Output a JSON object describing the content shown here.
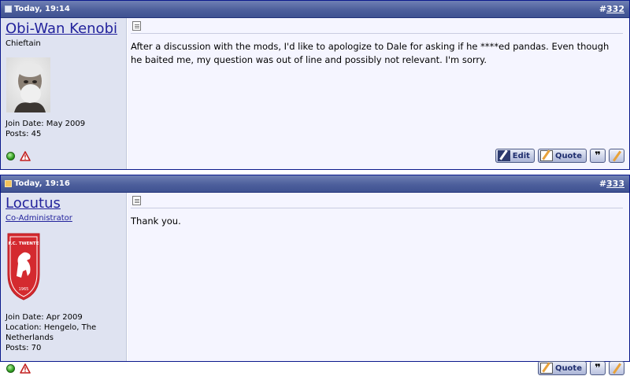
{
  "posts": [
    {
      "date": "Today, 19:14",
      "post_number_prefix": "#",
      "post_number": "332",
      "username": "Obi-Wan Kenobi",
      "user_title": "Chieftain",
      "join_date": "Join Date: May 2009",
      "location": "",
      "posts_count": "Posts: 45",
      "message": "After a discussion with the mods, I'd like to apologize to Dale for asking if he ****ed pandas. Even though he baited me, my question was out of line and possibly not relevant. I'm sorry.",
      "buttons": {
        "edit": "Edit",
        "quote": "Quote"
      }
    },
    {
      "date": "Today, 19:16",
      "post_number_prefix": "#",
      "post_number": "333",
      "username": "Locutus",
      "user_title": "Co-Administrator",
      "join_date": "Join Date: Apr 2009",
      "location": "Location: Hengelo, The Netherlands",
      "posts_count": "Posts: 70",
      "message": "Thank you.",
      "buttons": {
        "quote": "Quote"
      }
    }
  ],
  "avatar2": {
    "top_text": "F.C. TWENTE",
    "year": "1965"
  },
  "multiquote_glyph": "❞",
  "colors": {
    "header": "#4d5f9c",
    "user_panel": "#dfe3f1",
    "message_bg": "#f5f5ff",
    "link": "#22229c",
    "crest_red": "#d42a2f"
  },
  "icons": [
    "date-icon",
    "online-status-icon",
    "report-icon",
    "post-icon",
    "edit-icon",
    "quote-icon",
    "multiquote-icon",
    "quick-reply-icon",
    "avatar"
  ]
}
